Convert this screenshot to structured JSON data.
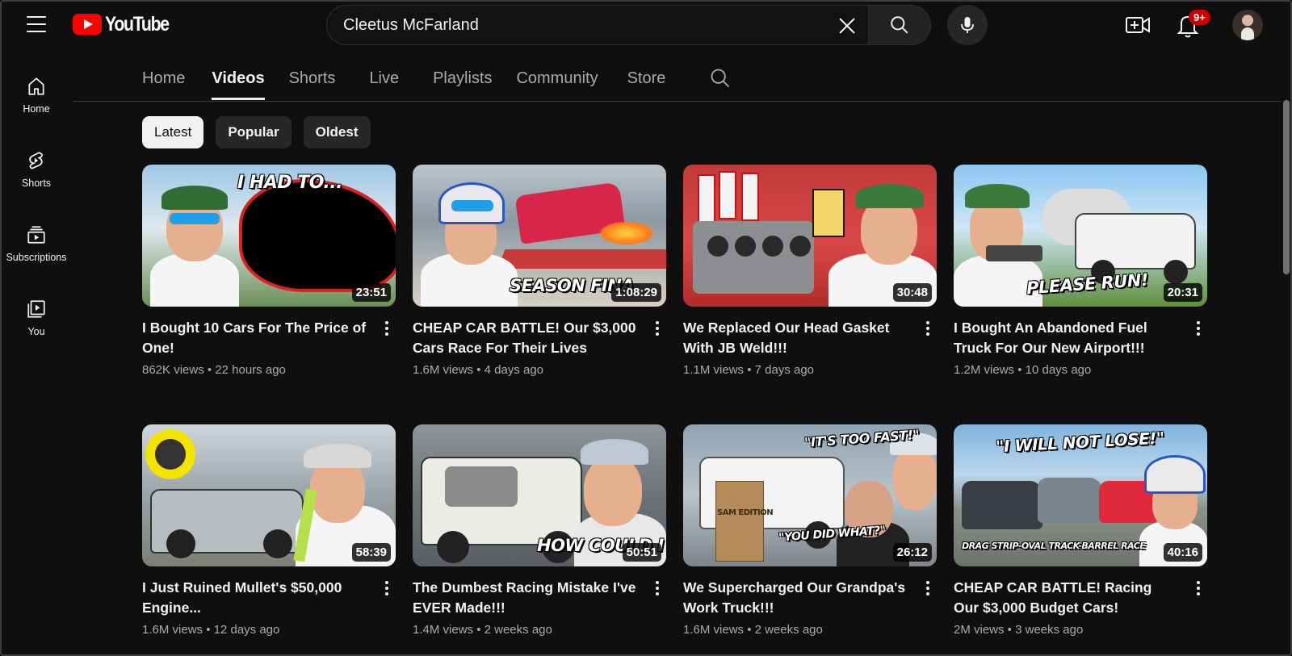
{
  "header": {
    "logo_text": "YouTube",
    "search": {
      "value": "Cleetus McFarland"
    },
    "notification_count": "9+"
  },
  "sidebar": {
    "items": [
      {
        "label": "Home",
        "icon": "home-icon"
      },
      {
        "label": "Shorts",
        "icon": "shorts-icon"
      },
      {
        "label": "Subscriptions",
        "icon": "subscriptions-icon"
      },
      {
        "label": "You",
        "icon": "you-icon"
      }
    ]
  },
  "tabs": [
    {
      "label": "Home",
      "active": false
    },
    {
      "label": "Videos",
      "active": true
    },
    {
      "label": "Shorts",
      "active": false
    },
    {
      "label": "Live",
      "active": false
    },
    {
      "label": "Playlists",
      "active": false
    },
    {
      "label": "Community",
      "active": false
    },
    {
      "label": "Store",
      "active": false
    }
  ],
  "chips": [
    {
      "label": "Latest",
      "selected": true
    },
    {
      "label": "Popular",
      "selected": false
    },
    {
      "label": "Oldest",
      "selected": false
    }
  ],
  "videos": [
    {
      "title": "I Bought 10 Cars For The Price of One!",
      "views": "862K views",
      "age": "22 hours ago",
      "duration": "23:51",
      "thumb_text": "I HAD TO..."
    },
    {
      "title": "CHEAP CAR BATTLE! Our $3,000 Cars Race For Their Lives",
      "views": "1.6M views",
      "age": "4 days ago",
      "duration": "1:08:29",
      "thumb_text": "SEASON FINA"
    },
    {
      "title": "We Replaced Our Head Gasket With JB Weld!!!",
      "views": "1.1M views",
      "age": "7 days ago",
      "duration": "30:48",
      "thumb_text": ""
    },
    {
      "title": "I Bought An Abandoned Fuel Truck For Our New Airport!!!",
      "views": "1.2M views",
      "age": "10 days ago",
      "duration": "20:31",
      "thumb_text": "PLEASE RUN!"
    },
    {
      "title": "I Just Ruined Mullet's $50,000 Engine...",
      "views": "1.6M views",
      "age": "12 days ago",
      "duration": "58:39",
      "thumb_text": ""
    },
    {
      "title": "The Dumbest Racing Mistake I've EVER Made!!!",
      "views": "1.4M views",
      "age": "2 weeks ago",
      "duration": "50:51",
      "thumb_text": "HOW COULD I"
    },
    {
      "title": "We Supercharged Our Grandpa's Work Truck!!!",
      "views": "1.6M views",
      "age": "2 weeks ago",
      "duration": "26:12",
      "thumb_text": "\"IT'S TOO FAST!\"",
      "thumb_text_2": "\"YOU DID WHAT?\"",
      "thumb_text_3": "SAM EDITION"
    },
    {
      "title": "CHEAP CAR BATTLE! Racing Our $3,000 Budget Cars!",
      "views": "2M views",
      "age": "3 weeks ago",
      "duration": "40:16",
      "thumb_text": "\"I WILL NOT LOSE!\"",
      "thumb_text_2": "DRAG STRIP-OVAL TRACK-BARREL RACE"
    }
  ],
  "colors": {
    "background": "#0f0f0f",
    "brand_red": "#ff0000",
    "badge_red": "#cc0000",
    "secondary_text": "#aaaaaa"
  }
}
